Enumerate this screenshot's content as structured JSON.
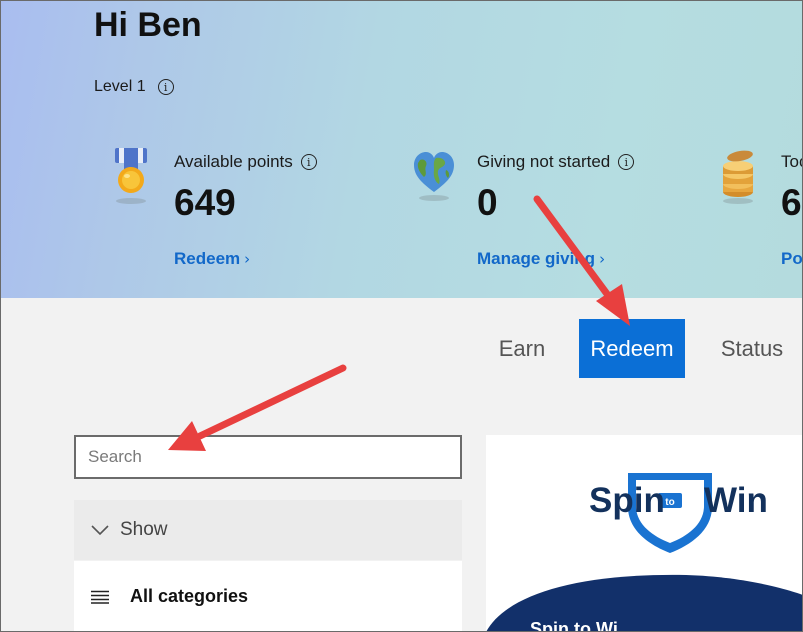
{
  "header": {
    "greeting": "Hi Ben",
    "level": "Level 1",
    "info_glyph": "i"
  },
  "stats": [
    {
      "label": "Available points",
      "value": "649",
      "link": "Redeem",
      "icon": "medal-icon"
    },
    {
      "label": "Giving not started",
      "value": "0",
      "link": "Manage giving",
      "icon": "heart-globe-icon"
    },
    {
      "label": "Toc",
      "value": "6",
      "link": "Po",
      "icon": "coins-stack-icon"
    }
  ],
  "tabs": [
    {
      "label": "Earn",
      "active": false
    },
    {
      "label": "Redeem",
      "active": true
    },
    {
      "label": "Status",
      "active": false
    }
  ],
  "search": {
    "placeholder": "Search"
  },
  "filter": {
    "show_label": "Show",
    "category_label": "All categories"
  },
  "card": {
    "logo_part1": "Spin",
    "logo_part2": "Win",
    "logo_badge": "to",
    "bottom_text": "Spin to Wi"
  },
  "colors": {
    "accent": "#0b6fd6",
    "link": "#1268c9",
    "arrow": "#e8403f",
    "logo_navy": "#13315c",
    "logo_blue": "#1a73d1"
  }
}
